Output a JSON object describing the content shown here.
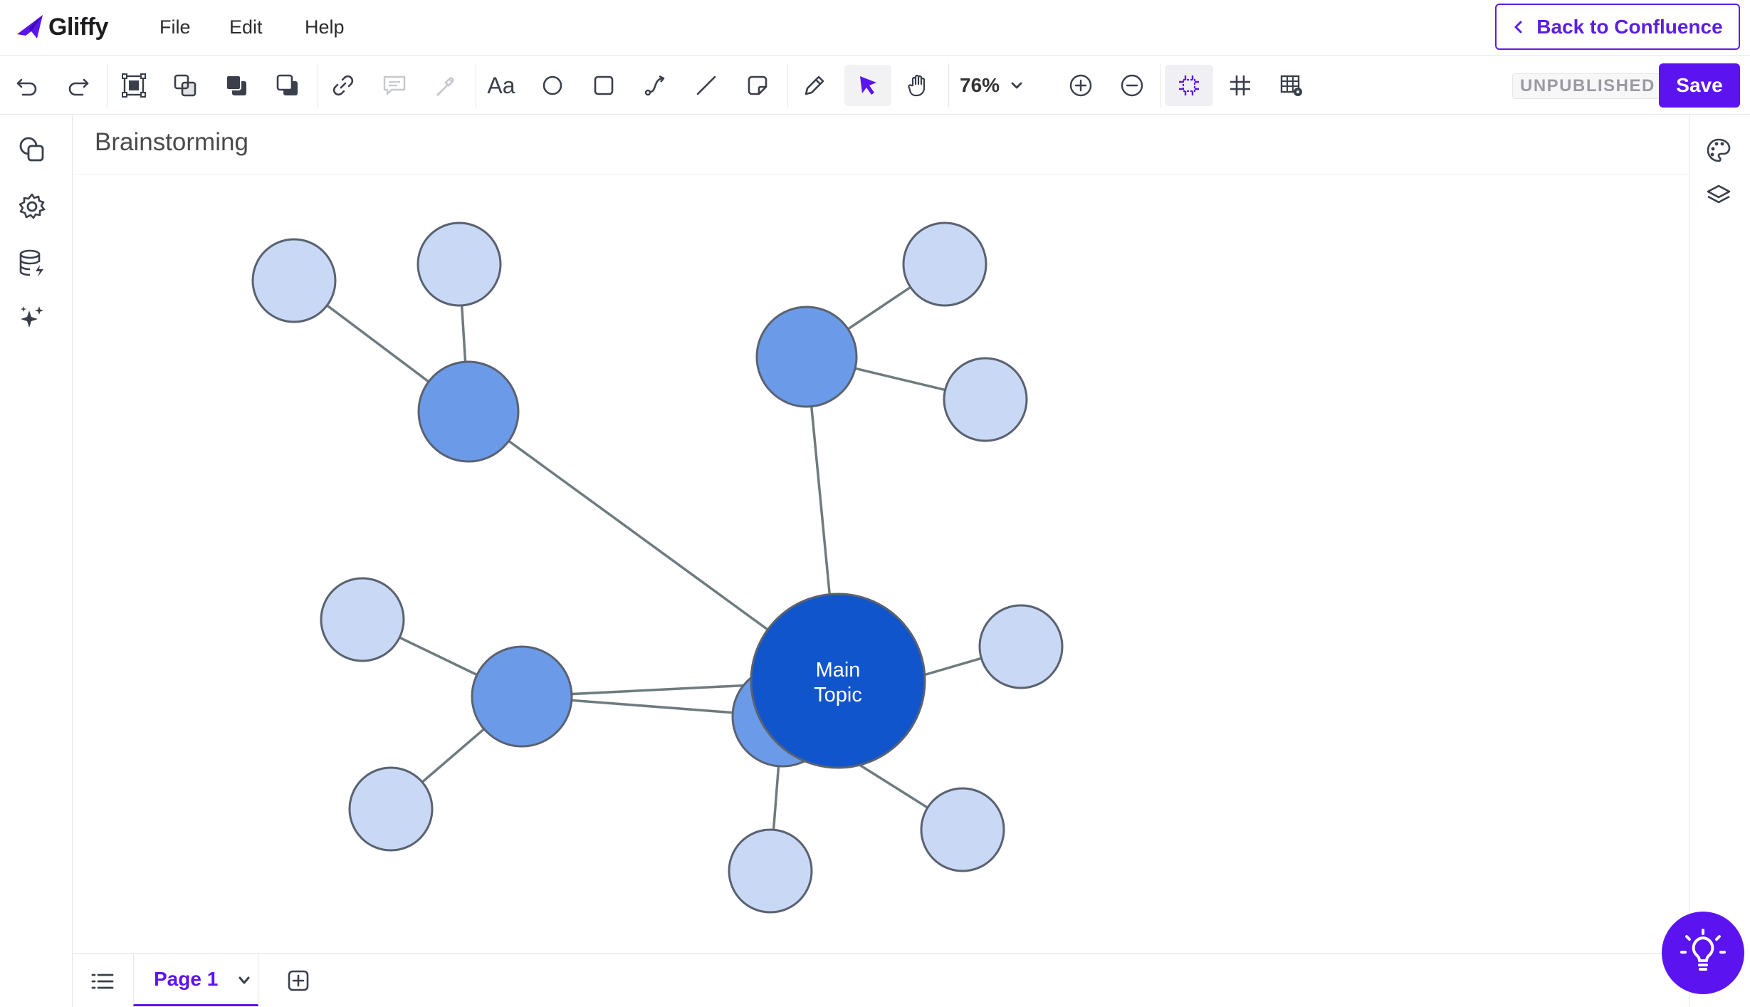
{
  "app": {
    "name": "Gliffy",
    "accent_color": "#5b14f0"
  },
  "menu": {
    "file": "File",
    "edit": "Edit",
    "help": "Help"
  },
  "header": {
    "back_label": "Back to Confluence"
  },
  "toolbar": {
    "tools": [
      "undo-icon",
      "redo-icon",
      "group-icon",
      "duplicate-icon",
      "bring-to-front-icon",
      "send-to-back-icon",
      "link-icon",
      "comment-icon",
      "eyedropper-icon",
      "text-tool-icon",
      "ellipse-tool-icon",
      "rectangle-tool-icon",
      "connector-tool-icon",
      "line-tool-icon",
      "sticky-note-tool-icon",
      "pencil-tool-icon",
      "pointer-tool-icon",
      "hand-tool-icon",
      "zoom-in-icon",
      "zoom-out-icon",
      "fit-to-frame-icon",
      "grid-icon",
      "table-settings-icon"
    ],
    "text_tool_label": "Aa",
    "active_tool": "pointer",
    "zoom_level": "76%",
    "status": "UNPUBLISHED",
    "save_label": "Save"
  },
  "left_sidebar": [
    "shapes-icon",
    "settings-icon",
    "data-icon",
    "ai-sparkle-icon"
  ],
  "right_sidebar": [
    "theme-palette-icon",
    "layers-icon"
  ],
  "document": {
    "title": "Brainstorming"
  },
  "diagram": {
    "type": "mind-map",
    "colors": {
      "main": "#1155cc",
      "branch": "#6b9be8",
      "leaf": "#c9d9f5",
      "edge": "#6e7b7f",
      "stroke": "#5a6270"
    },
    "main_topic": "Main Topic",
    "branches": [
      {
        "leaves": 2
      },
      {
        "leaves": 2
      },
      {
        "leaves": 2
      },
      {
        "leaves": 3
      }
    ]
  },
  "pages": {
    "current": "Page 1"
  }
}
